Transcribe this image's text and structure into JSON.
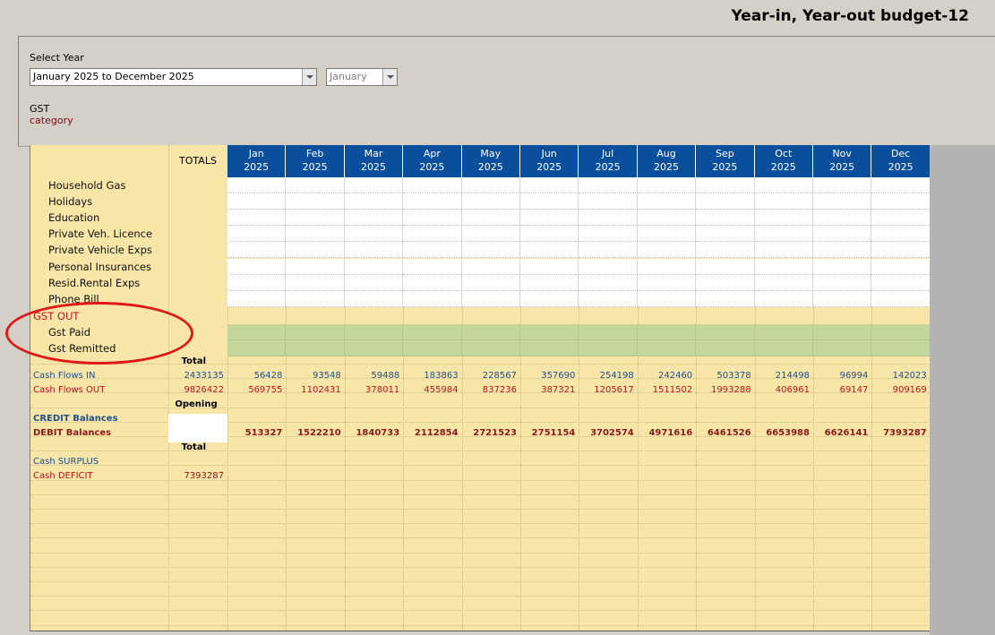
{
  "header": {
    "title": "Year-in, Year-out budget-12"
  },
  "controls": {
    "select_year_label": "Select Year",
    "year_value": "January 2025 to December 2025",
    "month_value": "January",
    "type_label": "GST",
    "type_sublabel": "category"
  },
  "table": {
    "totals_header": "TOTALS",
    "months": [
      {
        "m": "Jan",
        "y": "2025"
      },
      {
        "m": "Feb",
        "y": "2025"
      },
      {
        "m": "Mar",
        "y": "2025"
      },
      {
        "m": "Apr",
        "y": "2025"
      },
      {
        "m": "May",
        "y": "2025"
      },
      {
        "m": "Jun",
        "y": "2025"
      },
      {
        "m": "Jul",
        "y": "2025"
      },
      {
        "m": "Aug",
        "y": "2025"
      },
      {
        "m": "Sep",
        "y": "2025"
      },
      {
        "m": "Oct",
        "y": "2025"
      },
      {
        "m": "Nov",
        "y": "2025"
      },
      {
        "m": "Dec",
        "y": "2025"
      }
    ],
    "expense_rows": [
      "Household Gas",
      "Holidays",
      "Education",
      "Private Veh. Licence",
      "Private Vehicle Exps",
      "Personal Insurances",
      "Resid.Rental Exps",
      "Phone Bill"
    ],
    "gst_section": {
      "title": "GST OUT",
      "rows": [
        "Gst Paid",
        "Gst Remitted"
      ]
    },
    "summary": {
      "total_label": "Total",
      "cash_in_label": "Cash Flows IN",
      "cash_in_total": "2433135",
      "cash_in": [
        "56428",
        "93548",
        "59488",
        "183863",
        "228567",
        "357690",
        "254198",
        "242460",
        "503378",
        "214498",
        "96994",
        "142023"
      ],
      "cash_out_label": "Cash Flows OUT",
      "cash_out_total": "9826422",
      "cash_out": [
        "569755",
        "1102431",
        "378011",
        "455984",
        "837236",
        "387321",
        "1205617",
        "1511502",
        "1993288",
        "406961",
        "69147",
        "909169"
      ],
      "opening_label": "Opening",
      "credit_label": "CREDIT Balances",
      "debit_label": "DEBIT Balances",
      "debit": [
        "513327",
        "1522210",
        "1840733",
        "2112854",
        "2721523",
        "2751154",
        "3702574",
        "4971616",
        "6461526",
        "6653988",
        "6626141",
        "7393287"
      ],
      "total_label2": "Total",
      "surplus_label": "Cash SURPLUS",
      "deficit_label": "Cash DEFICIT",
      "deficit_total": "7393287"
    }
  },
  "colors": {
    "header_blue": "#0a4f9c",
    "sheet_beige": "#f8e6a8",
    "gst_green": "#c4d79b",
    "annotation_red": "#e01818"
  }
}
